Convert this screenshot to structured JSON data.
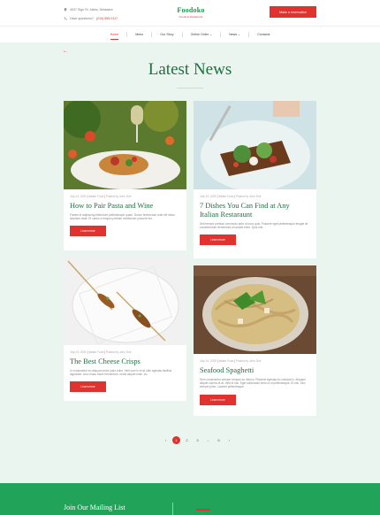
{
  "header": {
    "address": "4037 Sign St. Idaho, Delaware",
    "phone_label": "Have questions?",
    "phone": "(210) 555-0117",
    "logo_name": "Foodoko",
    "logo_tagline": "Foods & Restaurant",
    "reserve_label": "Make a reservation",
    "nav": [
      {
        "label": "Home"
      },
      {
        "label": "Menu"
      },
      {
        "label": "Our Story"
      },
      {
        "label": "Online Order ⌄"
      },
      {
        "label": "News ⌄"
      },
      {
        "label": "Contacts"
      }
    ]
  },
  "page": {
    "back_icon": "←",
    "title": "Latest News"
  },
  "posts": [
    {
      "meta_date": "July 24, 2020",
      "meta_cat": "Italian Food",
      "meta_author": "Posted by John Doe",
      "title": "How to Pair Pasta and Wine",
      "excerpt": "Fames et adipiscing bibendum pellentesque quam. Donec fermentum ante elit nibus faucibus vitae. Et varius a tempus pretium vestibulum posuere leo.",
      "more": "Learn more"
    },
    {
      "meta_date": "July 24, 2020",
      "meta_cat": "Italian Food",
      "meta_author": "Posted by John Doe",
      "title": "7 Dishes You Can Find at Any Italian Restaraunt",
      "excerpt": "Sed tempor pretium commodo ante ut nunc quis. Posuere eget pellentesque feugiat sit condimentum fermentum id laoreet enim. Quis nisl.",
      "more": "Learn more"
    },
    {
      "meta_date": "July 24, 2020",
      "meta_cat": "Italian Food",
      "meta_author": "Posted by John Doe",
      "title": "The Best Cheese Crisps",
      "excerpt": "In consectetur eu aliquam dolor justo enim. Velit cum in et at odio egestas facilisis dignissim. Arcu mass fusce fermentum, netus aliquet enim. Ac.",
      "more": "Learn more"
    },
    {
      "meta_date": "July 24, 2020",
      "meta_cat": "Italian Food",
      "meta_author": "Posted by John Doe",
      "title": "Seafood Spaghetti",
      "excerpt": "Sem consectetur semper tempus eu dictum. Placerat egestas eu volutpat in. Aliquam aliquet viverra et at. Velit et nisi. Eget sollicitudin enim ut id pellentesque. Et nisi. Sed semper justo. Laoreet pellentesque.",
      "more": "Learn more"
    }
  ],
  "pagination": {
    "prev": "‹",
    "pages": [
      "2",
      "3",
      "...",
      "6"
    ],
    "current": "1",
    "next": "›"
  },
  "footer": {
    "mailing_title": "Join Our Mailing List"
  },
  "colors": {
    "accent": "#e0322f",
    "brand_green": "#1f6f43",
    "page_bg": "#e9f5ee",
    "footer_green": "#22a35a"
  }
}
